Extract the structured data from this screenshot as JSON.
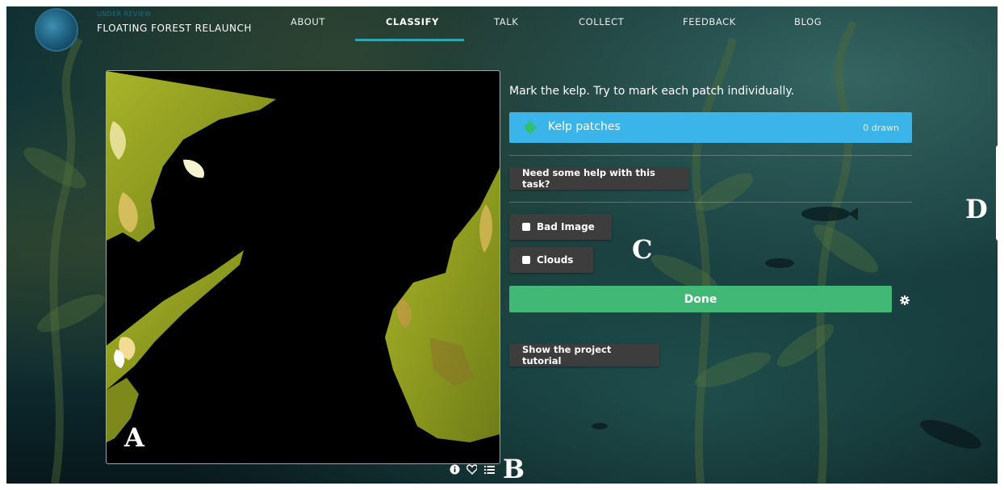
{
  "project": {
    "status": "UNDER REVIEW",
    "name": "FLOATING FOREST RELAUNCH"
  },
  "nav": {
    "links": [
      "ABOUT",
      "CLASSIFY",
      "TALK",
      "COLLECT",
      "FEEDBACK",
      "BLOG"
    ],
    "active": "CLASSIFY"
  },
  "task": {
    "instruction": "Mark the kelp. Try to mark each patch individually.",
    "tool": {
      "label": "Kelp patches",
      "count": "0 drawn",
      "color": "#2fbf71"
    },
    "help_button": "Need some help with this task?",
    "checkboxes": [
      "Bad Image",
      "Clouds"
    ],
    "done_button": "Done",
    "tutorial_button": "Show the project tutorial"
  },
  "viewer_tools": [
    "info-icon",
    "heart-icon",
    "list-icon"
  ],
  "panel_labels": {
    "a": "A",
    "b": "B",
    "c": "C",
    "d": "D"
  },
  "colors": {
    "tool_row": "#3bb4ea",
    "done_button": "#41b876",
    "dark_button": "#3d3d3d",
    "nav_active_underline": "#2ea7b0"
  }
}
